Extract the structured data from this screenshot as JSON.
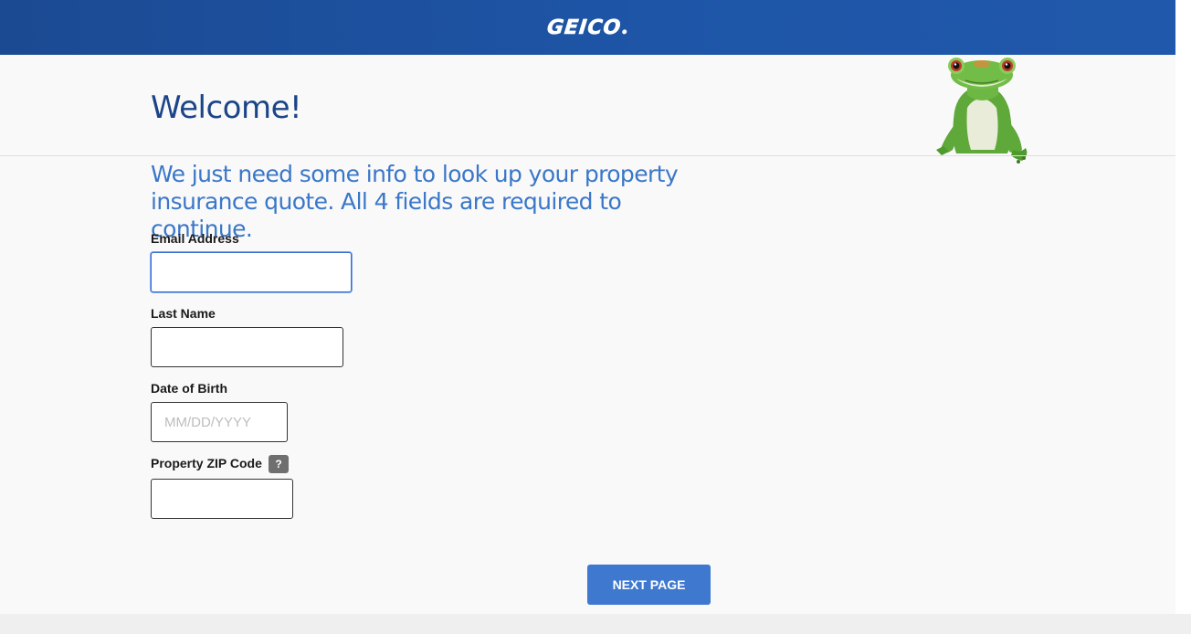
{
  "header": {
    "logo_text": "GEICO",
    "logo_mark": "®",
    "brand_color": "#1e55a7"
  },
  "page": {
    "title": "Welcome!",
    "intro": "We just need some info to look up your property insurance quote. All 4 fields are required to continue.",
    "mascot_icon": "gecko-mascot"
  },
  "form": {
    "email": {
      "label": "Email Address",
      "value": "",
      "placeholder": ""
    },
    "last_name": {
      "label": "Last Name",
      "value": "",
      "placeholder": ""
    },
    "dob": {
      "label": "Date of Birth",
      "value": "",
      "placeholder": "MM/DD/YYYY"
    },
    "zip": {
      "label": "Property ZIP Code",
      "value": "",
      "placeholder": "",
      "help_label": "?"
    }
  },
  "actions": {
    "next_label": "NEXT PAGE",
    "button_color": "#3f79cf"
  }
}
